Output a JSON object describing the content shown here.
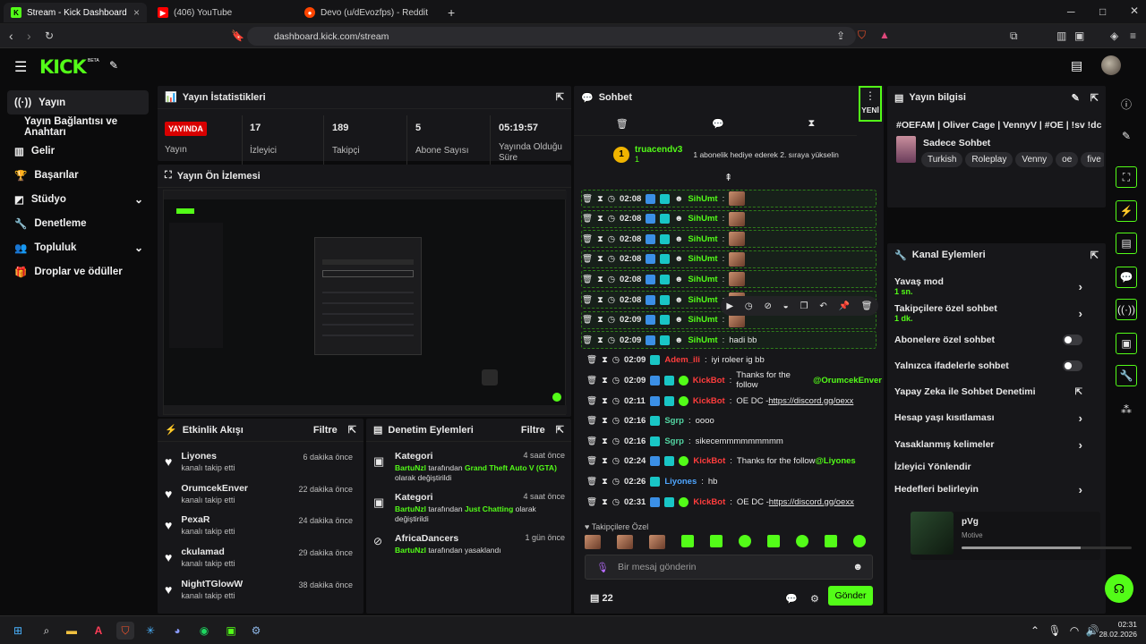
{
  "browser": {
    "tabs": [
      {
        "title": "Stream - Kick Dashboard",
        "active": true
      },
      {
        "title": "(406) YouTube",
        "active": false
      },
      {
        "title": "Devo (u/dEvozfps) - Reddit",
        "active": false
      }
    ],
    "url": "dashboard.kick.com/stream"
  },
  "sidebar": {
    "items": [
      {
        "label": "Yayın",
        "icon": "broadcast-icon"
      },
      {
        "label": "Yayın Bağlantısı ve Anahtarı",
        "icon": ""
      },
      {
        "label": "Gelir",
        "icon": "chart-icon"
      },
      {
        "label": "Başarılar",
        "icon": "trophy-icon"
      },
      {
        "label": "Stüdyo",
        "icon": "studio-icon"
      },
      {
        "label": "Denetleme",
        "icon": "wrench-icon"
      },
      {
        "label": "Topluluk",
        "icon": "people-icon"
      },
      {
        "label": "Droplar ve ödüller",
        "icon": "gift-icon"
      }
    ]
  },
  "stats": {
    "title": "Yayın İstatistikleri",
    "live_badge": "YAYINDA",
    "live_label": "Yayın",
    "items": [
      {
        "value": "17",
        "label": "İzleyici"
      },
      {
        "value": "189",
        "label": "Takipçi"
      },
      {
        "value": "5",
        "label": "Abone Sayısı"
      },
      {
        "value": "05:19:57",
        "label": "Yayında Olduğu Süre"
      }
    ]
  },
  "preview": {
    "title": "Yayın Ön İzlemesi"
  },
  "activity": {
    "title": "Etkinlik Akışı",
    "filter": "Filtre",
    "items": [
      {
        "name": "Liyones",
        "sub": "kanalı takip etti",
        "time": "6 dakika önce"
      },
      {
        "name": "OrumcekEnver",
        "sub": "kanalı takip etti",
        "time": "22 dakika önce"
      },
      {
        "name": "PexaR",
        "sub": "kanalı takip etti",
        "time": "24 dakika önce"
      },
      {
        "name": "ckulamad",
        "sub": "kanalı takip etti",
        "time": "29 dakika önce"
      },
      {
        "name": "NightTGlowW",
        "sub": "kanalı takip etti",
        "time": "38 dakika önce"
      }
    ]
  },
  "moderation": {
    "title": "Denetim Eylemleri",
    "filter": "Filtre",
    "items": [
      {
        "title": "Kategori",
        "time": "4 saat önce",
        "user": "BartuNzl",
        "mid": " tarafından ",
        "target": "Grand Theft Auto V (GTA)",
        "end": " olarak değiştirildi"
      },
      {
        "title": "Kategori",
        "time": "4 saat önce",
        "user": "BartuNzl",
        "mid": " tarafından ",
        "target": "Just Chatting",
        "end": " olarak değiştirildi"
      },
      {
        "title": "AfricaDancers",
        "time": "1 gün önce",
        "user": "BartuNzl",
        "mid": " tarafından yasaklandı",
        "target": "",
        "end": ""
      }
    ]
  },
  "chat": {
    "title": "Sohbet",
    "new_label": "YENİ",
    "gift_user": "truacendv3",
    "gift_count": "1",
    "gift_msg": "1 abonelik hediye ederek 2. sıraya yükselin",
    "lines": [
      {
        "time": "02:08",
        "user": "SihUmt",
        "msg": "",
        "color": "g",
        "hl": true
      },
      {
        "time": "02:08",
        "user": "SihUmt",
        "msg": "",
        "color": "g",
        "hl": true
      },
      {
        "time": "02:08",
        "user": "SihUmt",
        "msg": "",
        "color": "g",
        "hl": true
      },
      {
        "time": "02:08",
        "user": "SihUmt",
        "msg": "",
        "color": "g",
        "hl": true
      },
      {
        "time": "02:08",
        "user": "SihUmt",
        "msg": "",
        "color": "g",
        "hl": true
      },
      {
        "time": "02:08",
        "user": "SihUmt",
        "msg": "",
        "color": "g",
        "hl": true
      },
      {
        "time": "02:09",
        "user": "SihUmt",
        "msg": "",
        "color": "g",
        "hl": true
      },
      {
        "time": "02:09",
        "user": "SihUmt",
        "msg": "hadi bb",
        "color": "g",
        "hl": true
      },
      {
        "time": "02:09",
        "user": "Adem_ili",
        "msg": "iyi roleer ig bb",
        "color": "r",
        "hl": false
      },
      {
        "time": "02:09",
        "user": "KickBot",
        "msg": "Thanks for the follow ",
        "mention": "@OrumcekEnver",
        "color": "r",
        "hl": false
      },
      {
        "time": "02:11",
        "user": "KickBot",
        "msg": "OE DC - ",
        "link": "https://discord.gg/oexx",
        "color": "r",
        "hl": false
      },
      {
        "time": "02:16",
        "user": "Sgrp",
        "msg": "oooo",
        "color": "t",
        "hl": false
      },
      {
        "time": "02:16",
        "user": "Sgrp",
        "msg": "sikecemmmmmmmmm",
        "color": "t",
        "hl": false
      },
      {
        "time": "02:24",
        "user": "KickBot",
        "msg": "Thanks for the follow ",
        "mention": "@Liyones",
        "color": "r",
        "hl": false
      },
      {
        "time": "02:26",
        "user": "Liyones",
        "msg": "hb",
        "color": "b",
        "hl": false
      },
      {
        "time": "02:31",
        "user": "KickBot",
        "msg": "OE DC - ",
        "link": "https://discord.gg/oexx",
        "color": "r",
        "hl": false
      }
    ],
    "followers_label": "Takipçilere Özel",
    "input_placeholder": "Bir mesaj gönderin",
    "points": "22",
    "send_label": "Gönder"
  },
  "stream_info": {
    "title": "Yayın bilgisi",
    "stream_title": "#OEFAM | Oliver Cage | VennyV | #OE | !sv !dc",
    "category": "Sadece Sohbet",
    "tags": [
      "Turkish",
      "Roleplay",
      "Venny",
      "oe",
      "five"
    ]
  },
  "channel_actions": {
    "title": "Kanal Eylemleri",
    "items": [
      {
        "label": "Yavaş mod",
        "sub": "1 sn.",
        "type": "arrow"
      },
      {
        "label": "Takipçilere özel sohbet",
        "sub": "1 dk.",
        "type": "arrow"
      },
      {
        "label": "Abonelere özel sohbet",
        "sub": "",
        "type": "toggle"
      },
      {
        "label": "Yalnızca ifadelerle sohbet",
        "sub": "",
        "type": "toggle"
      },
      {
        "label": "Yapay Zeka ile Sohbet Denetimi",
        "sub": "",
        "type": "external"
      },
      {
        "label": "Hesap yaşı kısıtlaması",
        "sub": "",
        "type": "arrow"
      },
      {
        "label": "Yasaklanmış kelimeler",
        "sub": "",
        "type": "arrow"
      },
      {
        "label": "İzleyici Yönlendir",
        "sub": "",
        "type": "none"
      },
      {
        "label": "Hedefleri belirleyin",
        "sub": "",
        "type": "arrow"
      }
    ]
  },
  "media": {
    "title": "pVg",
    "artist": "Motive",
    "progress": 0.7
  },
  "taskbar": {
    "time": "02:31",
    "date": "28.02.2026"
  },
  "colors": {
    "accent": "#53fc18",
    "live": "#d80000",
    "kickbot": "#ff3d3d"
  }
}
